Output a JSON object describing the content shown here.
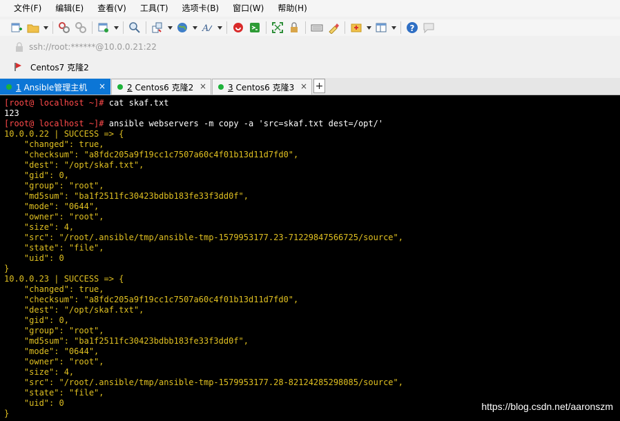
{
  "menu": [
    "文件(F)",
    "编辑(E)",
    "查看(V)",
    "工具(T)",
    "选项卡(B)",
    "窗口(W)",
    "帮助(H)"
  ],
  "toolbar_icons": [
    "new-session-icon",
    "open-folder-icon",
    "dropdown-arrow-icon",
    "disconnect-icon",
    "reconnect-icon",
    "properties-icon",
    "dropdown-arrow-icon",
    "find-icon",
    "transfer-icon",
    "dropdown-arrow-icon",
    "globe-icon",
    "dropdown-arrow-icon",
    "font-icon",
    "dropdown-arrow-icon",
    "xftp-icon",
    "xshell-icon",
    "fullscreen-icon",
    "lock-icon",
    "keyboard-icon",
    "highlight-icon",
    "compose-icon",
    "dropdown-arrow-icon",
    "layout-icon",
    "dropdown-arrow-icon",
    "help-icon",
    "chat-icon"
  ],
  "address": {
    "text": "ssh://root:******@10.0.0.21:22"
  },
  "session": {
    "label": "Centos7 克隆2"
  },
  "tabs": [
    {
      "num": "1",
      "label": "Ansible管理主机",
      "active": true
    },
    {
      "num": "2",
      "label": "Centos6 克隆2",
      "active": false
    },
    {
      "num": "3",
      "label": "Centos6 克隆3",
      "active": false
    }
  ],
  "tab_close": "×",
  "newtab": "+",
  "terminal": {
    "prompt": "[root@ localhost ~]#",
    "lines": [
      {
        "parts": [
          [
            "[root@ localhost ~]#",
            "red"
          ],
          [
            " cat skaf.txt",
            "white"
          ]
        ]
      },
      {
        "parts": [
          [
            "123",
            "white"
          ]
        ]
      },
      {
        "parts": [
          [
            "[root@ localhost ~]#",
            "red"
          ],
          [
            " ansible webservers -m copy -a 'src=skaf.txt dest=/opt/'",
            "white"
          ]
        ]
      },
      {
        "parts": [
          [
            "10.0.0.22 | SUCCESS => {",
            "yel"
          ]
        ]
      },
      {
        "parts": [
          [
            "    \"changed\": true,",
            "yel"
          ]
        ]
      },
      {
        "parts": [
          [
            "    \"checksum\": \"a8fdc205a9f19cc1c7507a60c4f01b13d11d7fd0\",",
            "yel"
          ]
        ]
      },
      {
        "parts": [
          [
            "    \"dest\": \"/opt/skaf.txt\",",
            "yel"
          ]
        ]
      },
      {
        "parts": [
          [
            "    \"gid\": 0,",
            "yel"
          ]
        ]
      },
      {
        "parts": [
          [
            "    \"group\": \"root\",",
            "yel"
          ]
        ]
      },
      {
        "parts": [
          [
            "    \"md5sum\": \"ba1f2511fc30423bdbb183fe33f3dd0f\",",
            "yel"
          ]
        ]
      },
      {
        "parts": [
          [
            "    \"mode\": \"0644\",",
            "yel"
          ]
        ]
      },
      {
        "parts": [
          [
            "    \"owner\": \"root\",",
            "yel"
          ]
        ]
      },
      {
        "parts": [
          [
            "    \"size\": 4,",
            "yel"
          ]
        ]
      },
      {
        "parts": [
          [
            "    \"src\": \"/root/.ansible/tmp/ansible-tmp-1579953177.23-71229847566725/source\",",
            "yel"
          ]
        ]
      },
      {
        "parts": [
          [
            "    \"state\": \"file\",",
            "yel"
          ]
        ]
      },
      {
        "parts": [
          [
            "    \"uid\": 0",
            "yel"
          ]
        ]
      },
      {
        "parts": [
          [
            "}",
            "yel"
          ]
        ]
      },
      {
        "parts": [
          [
            "10.0.0.23 | SUCCESS => {",
            "yel"
          ]
        ]
      },
      {
        "parts": [
          [
            "    \"changed\": true,",
            "yel"
          ]
        ]
      },
      {
        "parts": [
          [
            "    \"checksum\": \"a8fdc205a9f19cc1c7507a60c4f01b13d11d7fd0\",",
            "yel"
          ]
        ]
      },
      {
        "parts": [
          [
            "    \"dest\": \"/opt/skaf.txt\",",
            "yel"
          ]
        ]
      },
      {
        "parts": [
          [
            "    \"gid\": 0,",
            "yel"
          ]
        ]
      },
      {
        "parts": [
          [
            "    \"group\": \"root\",",
            "yel"
          ]
        ]
      },
      {
        "parts": [
          [
            "    \"md5sum\": \"ba1f2511fc30423bdbb183fe33f3dd0f\",",
            "yel"
          ]
        ]
      },
      {
        "parts": [
          [
            "    \"mode\": \"0644\",",
            "yel"
          ]
        ]
      },
      {
        "parts": [
          [
            "    \"owner\": \"root\",",
            "yel"
          ]
        ]
      },
      {
        "parts": [
          [
            "    \"size\": 4,",
            "yel"
          ]
        ]
      },
      {
        "parts": [
          [
            "    \"src\": \"/root/.ansible/tmp/ansible-tmp-1579953177.28-82124285298085/source\",",
            "yel"
          ]
        ]
      },
      {
        "parts": [
          [
            "    \"state\": \"file\",",
            "yel"
          ]
        ]
      },
      {
        "parts": [
          [
            "    \"uid\": 0",
            "yel"
          ]
        ]
      },
      {
        "parts": [
          [
            "}",
            "yel"
          ]
        ]
      }
    ]
  },
  "watermark": "https://blog.csdn.net/aaronszm",
  "colors": {
    "tab_active": "#0c76d6",
    "prompt_red": "#ff4a4a",
    "output_yellow": "#e0c021",
    "status_green": "#1eb23a"
  }
}
